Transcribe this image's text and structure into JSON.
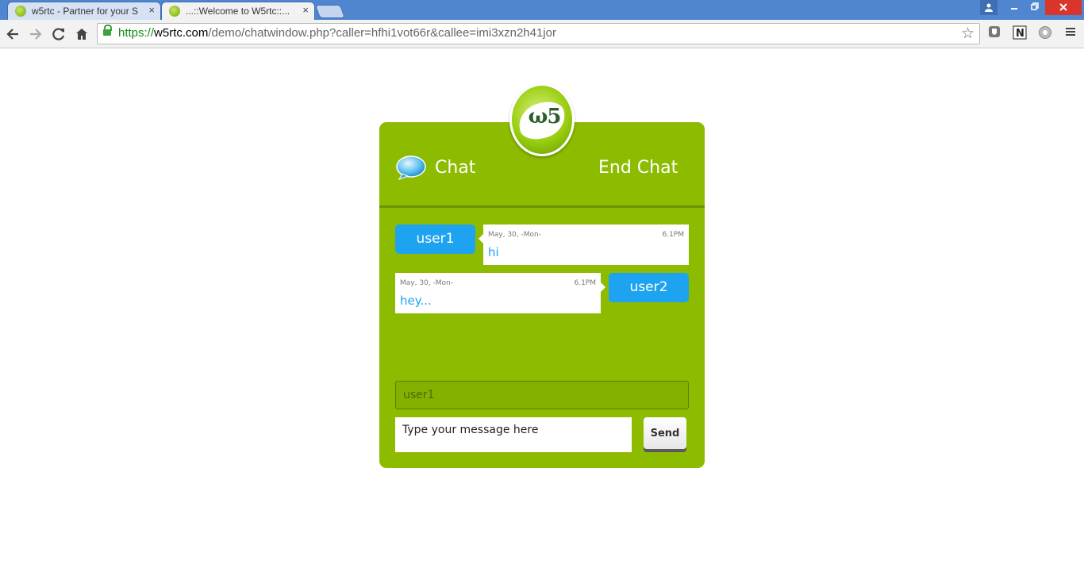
{
  "browser": {
    "tabs": [
      {
        "title": "w5rtc - Partner for your S",
        "active": false
      },
      {
        "title": "...::Welcome to W5rtc::...",
        "active": true
      }
    ],
    "url": {
      "scheme": "https://",
      "host": "w5rtc.com",
      "path": "/demo/chatwindow.php?caller=hfhi1vot66r&callee=imi3xzn2h41jor"
    },
    "close_glyph": "×"
  },
  "colors": {
    "panel": "#8cbb00",
    "user_pill": "#1ea3f0",
    "message_text": "#1ea3f0",
    "chrome_tabstrip": "#4f86cf",
    "close_button": "#d9352a"
  },
  "chat": {
    "logo_text": "ω5",
    "title": "Chat",
    "end_chat_label": "End Chat",
    "messages": [
      {
        "user": "user1",
        "date": "May, 30,  -Mon-",
        "time": "6.1PM",
        "text": "hi",
        "side": "left"
      },
      {
        "user": "user2",
        "date": "May, 30,  -Mon-",
        "time": "6.1PM",
        "text": "hey...",
        "side": "right"
      }
    ],
    "name_placeholder": "user1",
    "message_placeholder": "Type your message here",
    "send_label": "Send"
  }
}
